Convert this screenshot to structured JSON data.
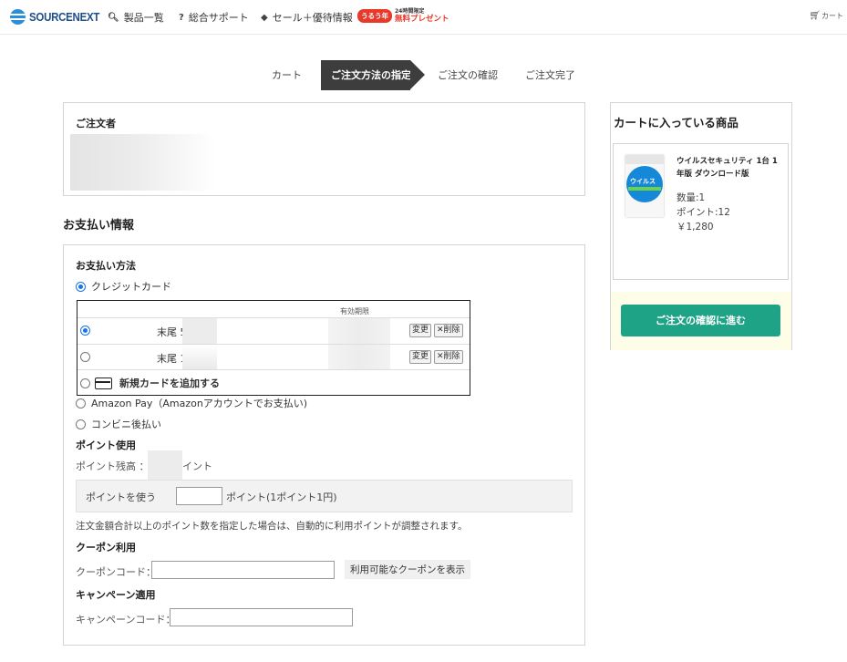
{
  "header": {
    "logo_text": "SOURCENEXT",
    "nav": [
      {
        "label": "製品一覧",
        "icon": "search-icon"
      },
      {
        "label": "総合サポート",
        "icon": "question-icon"
      },
      {
        "label": "セール＋優待情報",
        "icon": "tag-icon"
      }
    ],
    "promo_badge": "うるう年",
    "promo_small": "24時間限定",
    "promo_big": "無料プレゼント",
    "cart_label": "カート"
  },
  "steps": [
    "カート",
    "ご注文方法の指定",
    "ご注文の確認",
    "ご注文完了"
  ],
  "orderer": {
    "title": "ご注文者"
  },
  "payment": {
    "heading": "お支払い情報",
    "method_title": "お支払い方法",
    "credit_card_label": "クレジットカード",
    "expiry_header": "有効期限",
    "cards": [
      {
        "label": "末尾 5",
        "change": "変更",
        "delete": "削除",
        "selected": true
      },
      {
        "label": "末尾 1",
        "change": "変更",
        "delete": "削除",
        "selected": false
      }
    ],
    "new_card_label": "新規カードを追加する",
    "amazon_pay_label": "Amazon Pay（Amazonアカウントでお支払い)",
    "convenience_label": "コンビニ後払い"
  },
  "points": {
    "title": "ポイント使用",
    "balance_label": "ポイント残高 ：",
    "balance_suffix": "イント",
    "use_label": "ポイントを使う",
    "input_value": "",
    "unit_label": "ポイント(1ポイント1円)",
    "note": "注文金額合計以上のポイント数を指定した場合は、自動的に利用ポイントが調整されます。"
  },
  "coupon": {
    "title": "クーポン利用",
    "code_label": "クーポンコード：",
    "code_value": "",
    "show_button": "利用可能なクーポンを表示"
  },
  "campaign": {
    "title": "キャンペーン適用",
    "code_label": "キャンペーンコード：",
    "code_value": ""
  },
  "cart": {
    "title": "カートに入っている商品",
    "product_name": "ウイルスセキュリティ 1台 1年版 ダウンロード版",
    "package_text": "ウイルス",
    "quantity": "数量:1",
    "points": "ポイント:12",
    "price": "￥1,280",
    "checkout_button": "ご注文の確認に進む"
  },
  "colors": {
    "accent_green": "#1fa387",
    "step_active": "#3d3d3d",
    "logo_blue": "#1d4e89",
    "promo_red": "#e8392a"
  }
}
